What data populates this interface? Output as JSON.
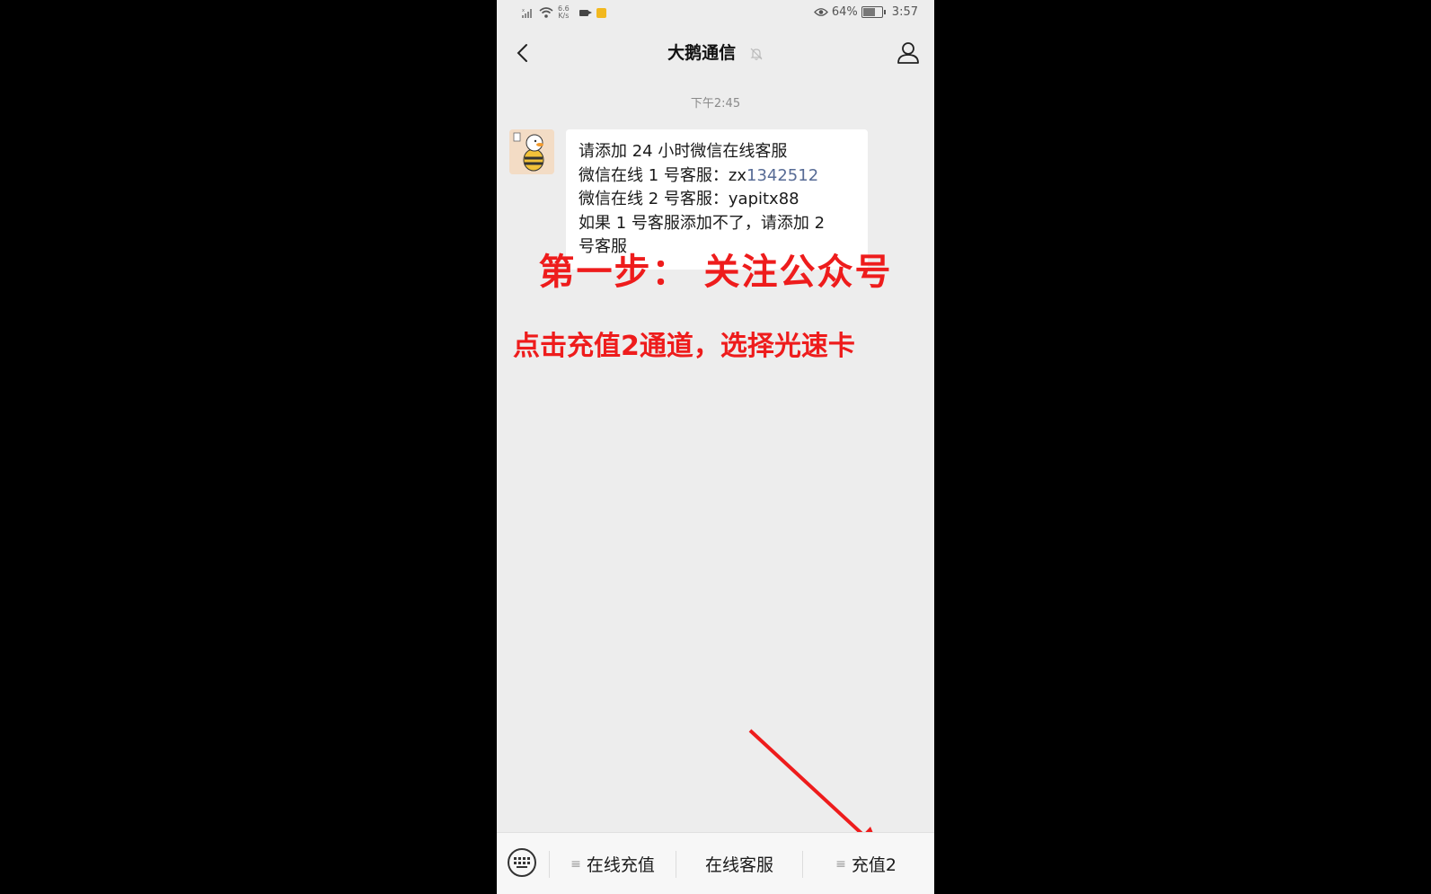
{
  "status_bar": {
    "net_speed_top": "6.6",
    "net_speed_bottom": "K/s",
    "battery": "64%",
    "time": "3:57",
    "icons": [
      "signal-icon",
      "wifi-icon",
      "video-icon",
      "app-notification-icon",
      "eye-icon",
      "battery-icon"
    ]
  },
  "header": {
    "title": "大鹅通信",
    "icons": [
      "back-icon",
      "mute-icon",
      "profile-icon"
    ]
  },
  "chat": {
    "timestamp": "下午2:45",
    "message": {
      "line1": "请添加 24 小时微信在线客服",
      "line2_prefix": "微信在线 1 号客服：zx",
      "line2_link": "1342512",
      "line3": "微信在线 2 号客服：yapitx88",
      "line4": "如果 1 号客服添加不了，请添加 2",
      "line5": "号客服"
    }
  },
  "overlay": {
    "step_heading": "第一步： 关注公众号",
    "instruction": "点击充值2通道，选择光速卡",
    "color": "#ee1c1c"
  },
  "menu": {
    "items": [
      {
        "label": "在线充值",
        "has_submenu": true
      },
      {
        "label": "在线客服",
        "has_submenu": false
      },
      {
        "label": "充值2",
        "has_submenu": true
      }
    ]
  }
}
